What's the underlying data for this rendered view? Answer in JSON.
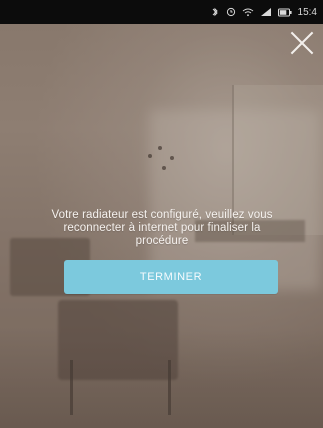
{
  "status_bar": {
    "time": "15:4",
    "icons": [
      "bluetooth-icon",
      "alarm-icon",
      "wifi-icon",
      "signal-icon",
      "battery-icon"
    ]
  },
  "dialog": {
    "close_icon": "close-icon",
    "message": "Votre radiateur est configuré, veuillez vous reconnecter à internet pour finaliser la procédure",
    "primary_button_label": "TERMINER",
    "accent_color": "#7cc9dd"
  }
}
